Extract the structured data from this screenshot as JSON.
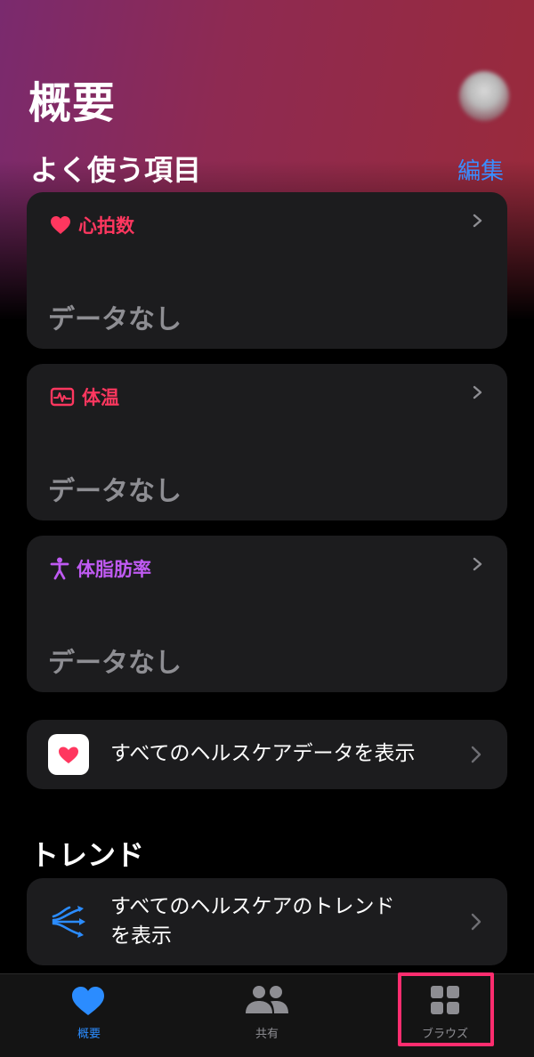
{
  "header": {
    "title": "概要"
  },
  "favorites": {
    "section_title": "よく使う項目",
    "edit_label": "編集",
    "cards": [
      {
        "label": "心拍数",
        "value": "データなし",
        "accent": "#ff375f",
        "icon": "heart-icon"
      },
      {
        "label": "体温",
        "value": "データなし",
        "accent": "#ff375f",
        "icon": "thermometer-wave-icon"
      },
      {
        "label": "体脂肪率",
        "value": "データなし",
        "accent": "#bf5af2",
        "icon": "body-figure-icon"
      }
    ],
    "show_all_label": "すべてのヘルスケアデータを表示"
  },
  "trends": {
    "section_title": "トレンド",
    "show_all_line1": "すべてのヘルスケアのトレンド",
    "show_all_line2": "を表示"
  },
  "tabbar": {
    "tabs": [
      {
        "label": "概要",
        "icon": "heart-icon",
        "active": true
      },
      {
        "label": "共有",
        "icon": "people-icon",
        "active": false
      },
      {
        "label": "ブラウズ",
        "icon": "grid-icon",
        "active": false
      }
    ]
  },
  "colors": {
    "link": "#3a8dff",
    "tab_active": "#2b8cff",
    "highlight": "#ff2d6f"
  }
}
